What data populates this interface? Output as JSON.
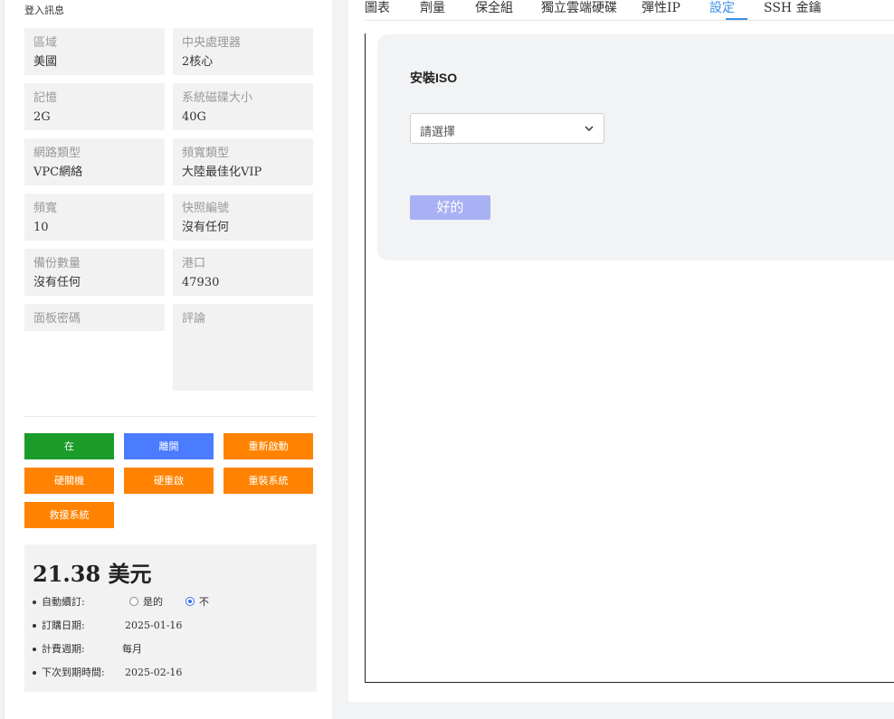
{
  "login": {
    "title": "登入訊息"
  },
  "info": [
    {
      "label": "區域",
      "value": "美國"
    },
    {
      "label": "中央處理器",
      "value": "2核心"
    },
    {
      "label": "記憶",
      "value": "2G"
    },
    {
      "label": "系統磁碟大小",
      "value": "40G"
    },
    {
      "label": "網路類型",
      "value": "VPC網絡"
    },
    {
      "label": "頻寬類型",
      "value": "大陸最佳化VIP"
    },
    {
      "label": "頻寬",
      "value": "10"
    },
    {
      "label": "快照編號",
      "value": "沒有任何"
    },
    {
      "label": "備份數量",
      "value": "沒有任何"
    },
    {
      "label": "港口",
      "value": "47930"
    },
    {
      "label": "面板密碼",
      "value": ""
    },
    {
      "label": "評論",
      "value": ""
    }
  ],
  "actions": {
    "on": "在",
    "off": "離開",
    "restart": "重新啟動",
    "hard_off": "硬關機",
    "hard_restart": "硬重啟",
    "reinstall": "重裝系統",
    "rescue": "救援系統"
  },
  "billing": {
    "price": "21.38 美元",
    "auto_renew_label": "自動續訂:",
    "auto_renew_yes": "是的",
    "auto_renew_no": "不",
    "auto_renew_selected": "不",
    "order_date_label": "訂購日期:",
    "order_date": "2025-01-16",
    "cycle_label": "計費週期:",
    "cycle": "每月",
    "next_due_label": "下次到期時間:",
    "next_due": "2025-02-16"
  },
  "tabs": [
    {
      "label": "圖表",
      "active": false
    },
    {
      "label": "劑量",
      "active": false
    },
    {
      "label": "保全組",
      "active": false
    },
    {
      "label": "獨立雲端硬碟",
      "active": false
    },
    {
      "label": "彈性IP",
      "active": false
    },
    {
      "label": "設定",
      "active": true
    },
    {
      "label": "SSH 金鑰",
      "active": false
    }
  ],
  "iso": {
    "title": "安裝ISO",
    "select_placeholder": "請選擇",
    "ok_label": "好的"
  },
  "colors": {
    "green": "#1a9b2a",
    "blue": "#4b7bff",
    "orange": "#ff8300",
    "tab_active": "#3a8ee6",
    "ok_button": "#a9b1f5"
  },
  "icons": {
    "select": "chevron-down-icon"
  }
}
